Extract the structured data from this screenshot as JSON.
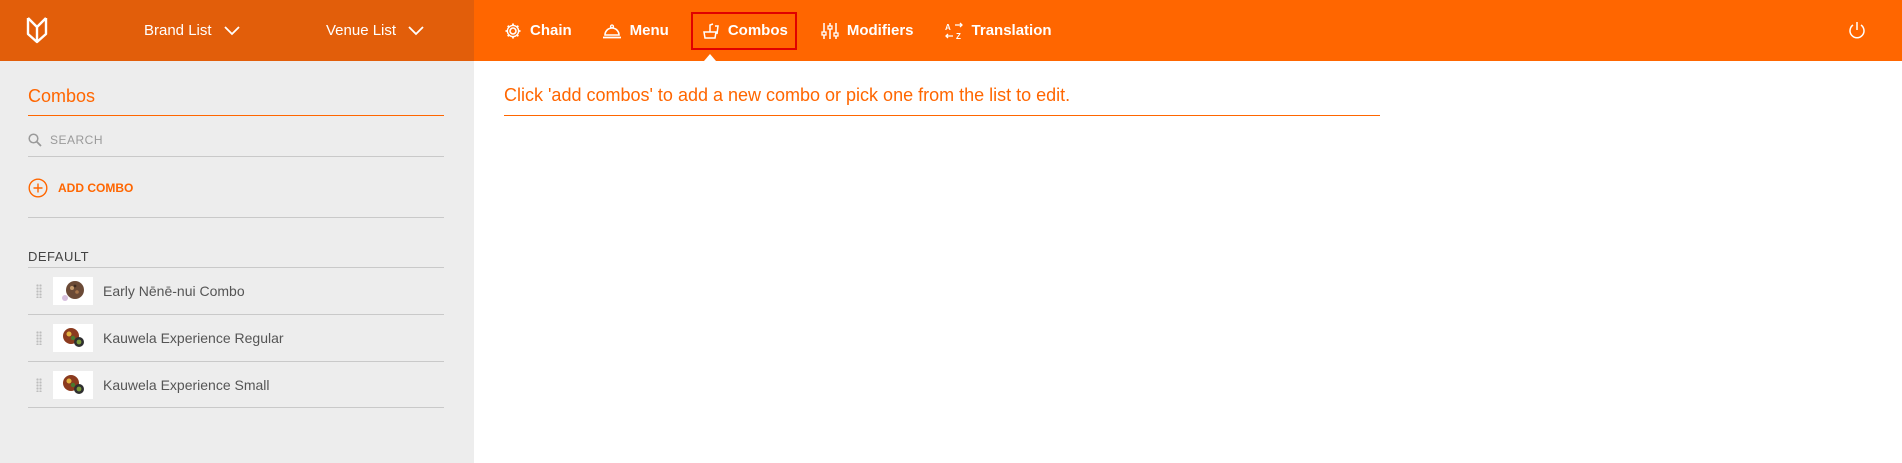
{
  "header": {
    "brand_dropdown": "Brand List",
    "venue_dropdown": "Venue List",
    "nav": [
      {
        "label": "Chain",
        "icon": "gear-icon",
        "active": false
      },
      {
        "label": "Menu",
        "icon": "cloche-icon",
        "active": false
      },
      {
        "label": "Combos",
        "icon": "combo-icon",
        "active": true
      },
      {
        "label": "Modifiers",
        "icon": "sliders-icon",
        "active": false
      },
      {
        "label": "Translation",
        "icon": "translate-icon",
        "active": false
      }
    ]
  },
  "sidebar": {
    "title": "Combos",
    "search_placeholder": "SEARCH",
    "add_label": "ADD COMBO",
    "group_label": "DEFAULT",
    "items": [
      {
        "label": "Early Nēnē-nui Combo",
        "thumb": "round-brown"
      },
      {
        "label": "Kauwela Experience Regular",
        "thumb": "plate-mixed"
      },
      {
        "label": "Kauwela Experience Small",
        "thumb": "plate-mixed"
      }
    ]
  },
  "main": {
    "message": "Click 'add combos' to add a new combo or pick one from the list to edit."
  },
  "colors": {
    "accent": "#ff6600",
    "header_left": "#e25e0a",
    "sidebar_bg": "#ededed",
    "active_border": "#e00000"
  }
}
